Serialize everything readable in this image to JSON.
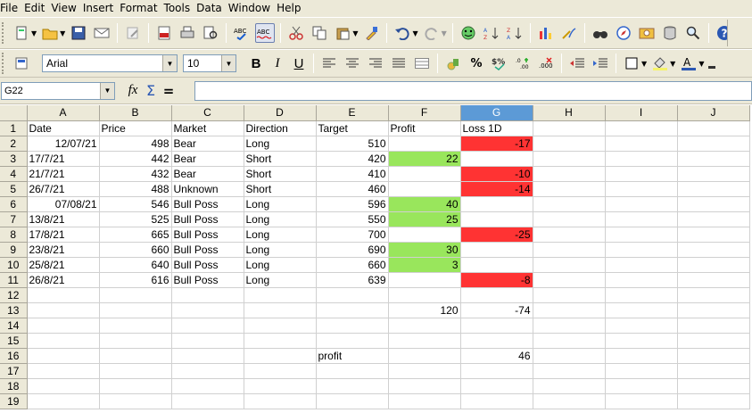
{
  "menu": [
    "File",
    "Edit",
    "View",
    "Insert",
    "Format",
    "Tools",
    "Data",
    "Window",
    "Help"
  ],
  "toolbar_icons": [
    "new-icon",
    "open-icon",
    "save-icon",
    "email-icon",
    "edit-file-icon",
    "pdf-icon",
    "print-icon",
    "page-preview-icon",
    "spellcheck-icon",
    "autospellcheck-icon",
    "cut-icon",
    "copy-icon",
    "paste-icon",
    "clone-formatting-icon",
    "undo-icon",
    "redo-icon",
    "navigator-icon",
    "sort-ascending-icon",
    "sort-descending-icon",
    "chart-icon",
    "draw-functions-icon",
    "find-icon",
    "navigator-icon",
    "gallery-icon",
    "data-sources-icon",
    "zoom-icon",
    "help-icon"
  ],
  "format": {
    "font_name": "Arial",
    "font_size": "10",
    "bold": "B",
    "italic": "I",
    "underline": "U",
    "percent": "%"
  },
  "formula_bar": {
    "name_box": "G22",
    "fx": "fx",
    "sigma": "Σ",
    "equals": "=",
    "content": ""
  },
  "columns": [
    "A",
    "B",
    "C",
    "D",
    "E",
    "F",
    "G",
    "H",
    "I",
    "J"
  ],
  "selected_column": "G",
  "rows": [
    {
      "n": "1",
      "cells": [
        "Date",
        "Price",
        "Market",
        "Direction",
        "Target",
        "Profit",
        "Loss 1D",
        "",
        "",
        ""
      ]
    },
    {
      "n": "2",
      "cells": [
        "12/07/21",
        "498",
        "Bear",
        "Long",
        "510",
        "",
        "-17",
        "",
        "",
        ""
      ]
    },
    {
      "n": "3",
      "cells": [
        "17/7/21",
        "442",
        "Bear",
        "Short",
        "420",
        "22",
        "",
        "",
        "",
        ""
      ]
    },
    {
      "n": "4",
      "cells": [
        "21/7/21",
        "432",
        "Bear",
        "Short",
        "410",
        "",
        "-10",
        "",
        "",
        ""
      ]
    },
    {
      "n": "5",
      "cells": [
        "26/7/21",
        "488",
        "Unknown",
        "Short",
        "460",
        "",
        "-14",
        "",
        "",
        ""
      ]
    },
    {
      "n": "6",
      "cells": [
        "07/08/21",
        "546",
        "Bull Poss",
        "Long",
        "596",
        "40",
        "",
        "",
        "",
        ""
      ]
    },
    {
      "n": "7",
      "cells": [
        "13/8/21",
        "525",
        "Bull Poss",
        "Long",
        "550",
        "25",
        "",
        "",
        "",
        ""
      ]
    },
    {
      "n": "8",
      "cells": [
        "17/8/21",
        "665",
        "Bull Poss",
        "Long",
        "700",
        "",
        "-25",
        "",
        "",
        ""
      ]
    },
    {
      "n": "9",
      "cells": [
        "23/8/21",
        "660",
        "Bull Poss",
        "Long",
        "690",
        "30",
        "",
        "",
        "",
        ""
      ]
    },
    {
      "n": "10",
      "cells": [
        "25/8/21",
        "640",
        "Bull Poss",
        "Long",
        "660",
        "3",
        "",
        "",
        "",
        ""
      ]
    },
    {
      "n": "11",
      "cells": [
        "26/8/21",
        "616",
        "Bull Poss",
        "Long",
        "639",
        "",
        "-8",
        "",
        "",
        ""
      ]
    },
    {
      "n": "12",
      "cells": [
        "",
        "",
        "",
        "",
        "",
        "",
        "",
        "",
        "",
        ""
      ]
    },
    {
      "n": "13",
      "cells": [
        "",
        "",
        "",
        "",
        "",
        "120",
        "-74",
        "",
        "",
        ""
      ]
    },
    {
      "n": "14",
      "cells": [
        "",
        "",
        "",
        "",
        "",
        "",
        "",
        "",
        "",
        ""
      ]
    },
    {
      "n": "15",
      "cells": [
        "",
        "",
        "",
        "",
        "",
        "",
        "",
        "",
        "",
        ""
      ]
    },
    {
      "n": "16",
      "cells": [
        "",
        "",
        "",
        "",
        "profit",
        "",
        "46",
        "",
        "",
        ""
      ]
    },
    {
      "n": "17",
      "cells": [
        "",
        "",
        "",
        "",
        "",
        "",
        "",
        "",
        "",
        ""
      ]
    },
    {
      "n": "18",
      "cells": [
        "",
        "",
        "",
        "",
        "",
        "",
        "",
        "",
        "",
        ""
      ]
    },
    {
      "n": "19",
      "cells": [
        "",
        "",
        "",
        "",
        "",
        "",
        "",
        "",
        "",
        ""
      ]
    }
  ],
  "cell_colors": {
    "profit_fill": "#99e65c",
    "loss_fill": "#ff3333"
  }
}
